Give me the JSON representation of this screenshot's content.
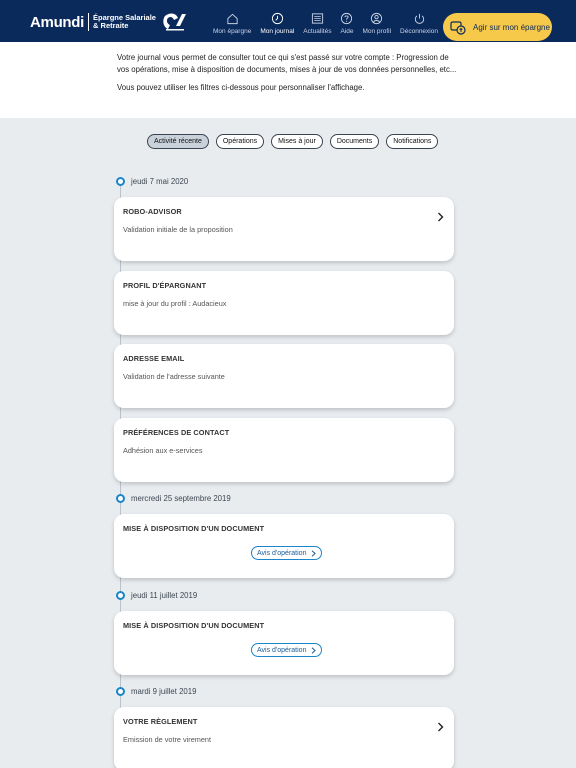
{
  "header": {
    "logo": {
      "brand": "Amundi",
      "sub_line1": "Épargne Salariale",
      "sub_line2": "& Retraite"
    },
    "nav": [
      {
        "label": "Mon épargne",
        "icon": "home-icon"
      },
      {
        "label": "Mon journal",
        "icon": "clock-icon"
      },
      {
        "label": "Actualités",
        "icon": "news-icon"
      },
      {
        "label": "Aide",
        "icon": "help-icon"
      },
      {
        "label": "Mon profil",
        "icon": "user-icon"
      },
      {
        "label": "Déconnexion",
        "icon": "power-icon"
      }
    ],
    "cta_label": "Agir sur mon épargne"
  },
  "intro": {
    "p1": "Votre journal vous permet de consulter tout ce qui s'est passé sur votre compte : Progression de vos opérations, mise à disposition de documents, mises à jour de vos données personnelles, etc...",
    "p2": "Vous pouvez utiliser les filtres ci-dessous pour personnaliser l'affichage."
  },
  "filters": [
    "Activité récente",
    "Opérations",
    "Mises à jour",
    "Documents",
    "Notifications"
  ],
  "active_filter": "Activité récente",
  "timeline": {
    "dates": [
      "jeudi 7 mai 2020",
      "mercredi 25 septembre 2019",
      "jeudi 11 juillet 2019",
      "mardi 9 juillet 2019"
    ],
    "cards": [
      {
        "title": "ROBO-ADVISOR",
        "subtitle": "Validation initiale de la proposition"
      },
      {
        "title": "PROFIL D'ÉPARGNANT",
        "subtitle": "mise à jour du profil : Audacieux"
      },
      {
        "title": "ADRESSE EMAIL",
        "subtitle": "Validation de l'adresse suivante"
      },
      {
        "title": "PRÉFÉRENCES DE CONTACT",
        "subtitle": "Adhésion aux e-services"
      },
      {
        "title": "MISE À DISPOSITION D'UN DOCUMENT",
        "button": "Avis d'opération"
      },
      {
        "title": "MISE À DISPOSITION D'UN DOCUMENT",
        "button": "Avis d'opération"
      },
      {
        "title": "VOTRE RÈGLEMENT",
        "subtitle": "Emission de votre virement"
      }
    ]
  },
  "colors": {
    "header_bg": "#0a2a5c",
    "accent_blue": "#1a85c8",
    "cta_yellow": "#f6c94a"
  }
}
